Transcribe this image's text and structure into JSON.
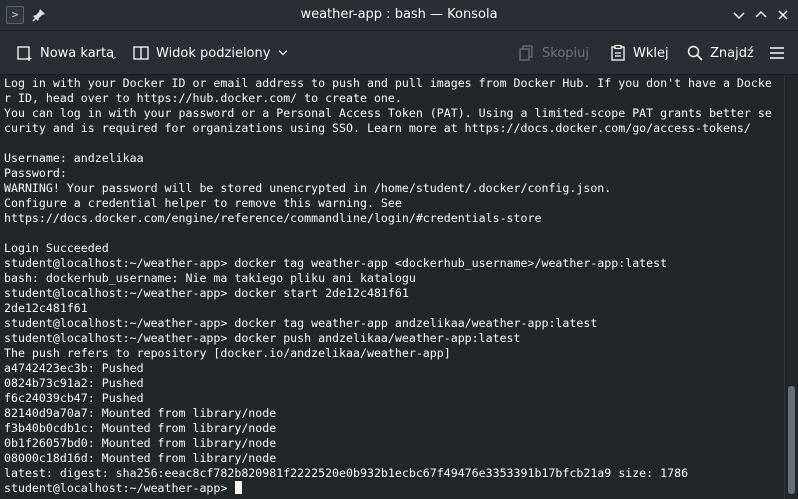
{
  "window": {
    "title": "weather-app : bash — Konsola",
    "app_icon": "terminal-icon",
    "controls": [
      "minimize-icon",
      "maximize-icon",
      "close-icon"
    ]
  },
  "toolbar": {
    "new_tab": "Nowa karta",
    "split_view": "Widok podzielony",
    "copy": "Skopiuj",
    "paste": "Wklej",
    "find": "Znajdź"
  },
  "terminal": {
    "lines": [
      "Log in with your Docker ID or email address to push and pull images from Docker Hub. If you don't have a Docke",
      "r ID, head over to https://hub.docker.com/ to create one.",
      "You can log in with your password or a Personal Access Token (PAT). Using a limited-scope PAT grants better se",
      "curity and is required for organizations using SSO. Learn more at https://docs.docker.com/go/access-tokens/",
      "",
      "Username: andzelikaa",
      "Password:",
      "WARNING! Your password will be stored unencrypted in /home/student/.docker/config.json.",
      "Configure a credential helper to remove this warning. See",
      "https://docs.docker.com/engine/reference/commandline/login/#credentials-store",
      "",
      "Login Succeeded",
      "student@localhost:~/weather-app> docker tag weather-app <dockerhub_username>/weather-app:latest",
      "bash: dockerhub_username: Nie ma takiego pliku ani katalogu",
      "student@localhost:~/weather-app> docker start 2de12c481f61",
      "2de12c481f61",
      "student@localhost:~/weather-app> docker tag weather-app andzelikaa/weather-app:latest",
      "student@localhost:~/weather-app> docker push andzelikaa/weather-app:latest",
      "The push refers to repository [docker.io/andzelikaa/weather-app]",
      "a4742423ec3b: Pushed",
      "0824b73c91a2: Pushed",
      "f6c24039cb47: Pushed",
      "82140d9a70a7: Mounted from library/node",
      "f3b40b0cdb1c: Mounted from library/node",
      "0b1f26057bd0: Mounted from library/node",
      "08000c18d16d: Mounted from library/node",
      "latest: digest: sha256:eeac8cf782b820981f2222520e0b932b1ecbc67f49476e3353391b17bfcb21a9 size: 1786"
    ],
    "prompt": "student@localhost:~/weather-app> "
  },
  "colors": {
    "background": "#232629",
    "chrome": "#2a2e32",
    "text": "#fcfcfc"
  }
}
